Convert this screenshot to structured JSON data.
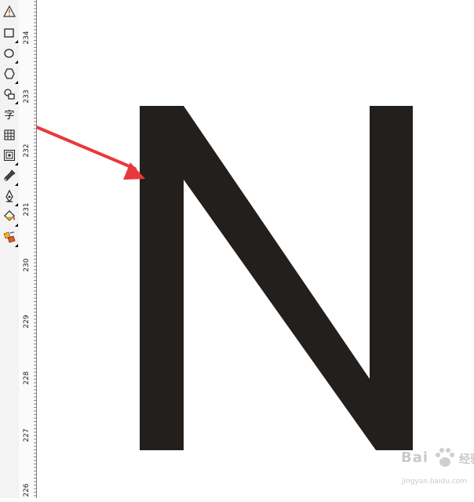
{
  "toolbox": {
    "tools": [
      {
        "name": "smart-fill-tool",
        "icon": "triangle-warning-icon",
        "flyout": false
      },
      {
        "name": "rectangle-tool",
        "icon": "rectangle-icon",
        "flyout": true
      },
      {
        "name": "ellipse-tool",
        "icon": "ellipse-icon",
        "flyout": true
      },
      {
        "name": "polygon-tool",
        "icon": "polygon-icon",
        "flyout": true
      },
      {
        "name": "basic-shapes-tool",
        "icon": "basic-shapes-icon",
        "flyout": true
      },
      {
        "name": "text-tool",
        "icon": "text-icon",
        "glyph": "字",
        "flyout": false
      },
      {
        "name": "table-tool",
        "icon": "table-icon",
        "flyout": false
      },
      {
        "name": "contour-tool",
        "icon": "contour-icon",
        "flyout": true
      },
      {
        "name": "eyedropper-tool",
        "icon": "eyedropper-icon",
        "flyout": true
      },
      {
        "name": "outline-pen-tool",
        "icon": "pen-nib-icon",
        "flyout": true
      },
      {
        "name": "fill-tool",
        "icon": "paint-bucket-icon",
        "flyout": true
      },
      {
        "name": "interactive-fill-tool",
        "icon": "interactive-fill-icon",
        "flyout": true
      }
    ]
  },
  "ruler": {
    "labels": [
      "234",
      "233",
      "232",
      "231",
      "230",
      "229",
      "228",
      "227",
      "226"
    ]
  },
  "canvas": {
    "letter": "N",
    "letter_color": "#231f1c",
    "arrow_color": "#e8383b"
  },
  "watermark": {
    "brand": "Bai",
    "suffix": "经验",
    "url": "jingyan.baidu.com",
    "color": "#c9c9c9"
  }
}
